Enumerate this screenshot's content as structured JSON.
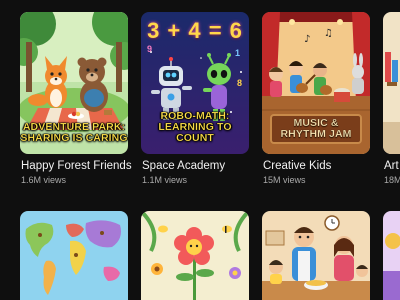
{
  "row1": [
    {
      "title": "Happy Forest Friends",
      "views": "1.6M views",
      "caption": "Adventure Park:\nSharing is Caring"
    },
    {
      "title": "Space Academy",
      "views": "1.1M views",
      "caption": "Robo-Math:\nLearning to Count",
      "equation": "3 + 4 = 6"
    },
    {
      "title": "Creative Kids",
      "views": "15M views",
      "caption": "Music &\nRhythm Jam"
    },
    {
      "title": "Art",
      "views": "18M"
    }
  ],
  "row2": [
    {
      "thumb": "world-map"
    },
    {
      "thumb": "flower-garden"
    },
    {
      "thumb": "family-cooking"
    },
    {
      "thumb": "partial"
    }
  ],
  "colors": {
    "background": "#0f0f0f",
    "title": "#f1f1f1",
    "meta": "#aaaaaa",
    "caption_yellow": "#ffe14a"
  }
}
